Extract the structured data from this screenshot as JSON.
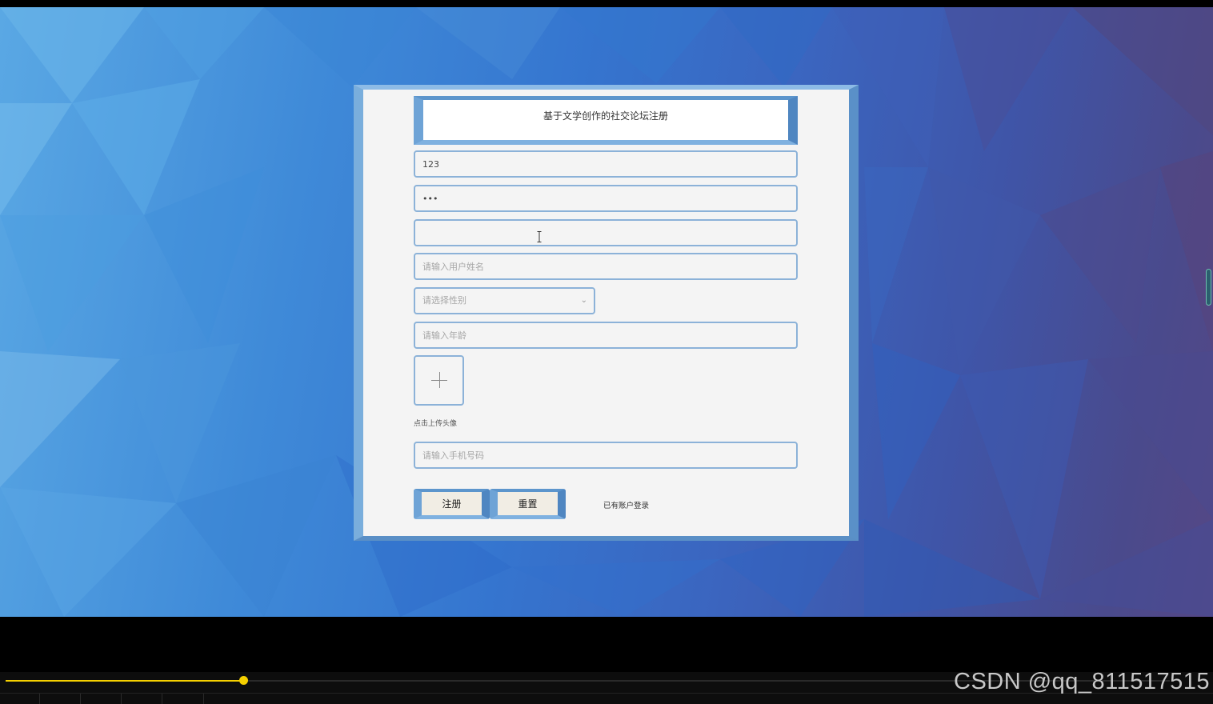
{
  "form": {
    "title": "基于文学创作的社交论坛注册",
    "username_value": "123",
    "password_value": "•••",
    "confirm_password_value": "",
    "fullname_placeholder": "请输入用户姓名",
    "gender_placeholder": "请选择性别",
    "age_placeholder": "请输入年龄",
    "avatar_label": "点击上传头像",
    "phone_placeholder": "请输入手机号码",
    "register_label": "注册",
    "reset_label": "重置",
    "login_link": "已有账户登录"
  },
  "video": {
    "progress": 0.204
  },
  "watermark": "CSDN @qq_811517515",
  "colors": {
    "accent": "#6fa6d8",
    "field_border": "#8cb2d8",
    "panel": "#f4f4f4",
    "progress": "#f5d000"
  }
}
